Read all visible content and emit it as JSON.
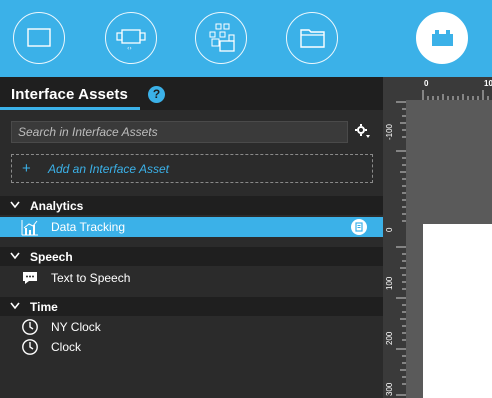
{
  "toolbar": {
    "buttons": [
      {
        "icon": "screen-icon"
      },
      {
        "icon": "component-icon"
      },
      {
        "icon": "shapes-icon"
      },
      {
        "icon": "folder-icon"
      },
      {
        "icon": "interface-assets-icon",
        "active": true
      }
    ]
  },
  "panel": {
    "title": "Interface Assets",
    "help": "?",
    "search": {
      "placeholder": "Search in Interface Assets",
      "value": ""
    },
    "add_asset": {
      "plus": "+",
      "label": "Add an Interface Asset"
    },
    "groups": [
      {
        "label": "Analytics",
        "items": [
          {
            "label": "Data Tracking",
            "icon": "bar-chart-icon",
            "selected": true
          }
        ]
      },
      {
        "label": "Speech",
        "items": [
          {
            "label": "Text to Speech",
            "icon": "speech-bubble-icon"
          }
        ]
      },
      {
        "label": "Time",
        "items": [
          {
            "label": "NY Clock",
            "icon": "clock-icon"
          },
          {
            "label": "Clock",
            "icon": "clock-icon"
          }
        ]
      }
    ]
  },
  "rulers": {
    "top": [
      "0",
      "10"
    ],
    "left": [
      "-100",
      "0",
      "100",
      "200",
      "300"
    ]
  },
  "colors": {
    "accent": "#3bb1e8",
    "panel_bg": "#2b2b2b",
    "header_bg": "#1f1f1f",
    "canvas_bg": "#5a5a5a",
    "artboard": "#ffffff"
  }
}
